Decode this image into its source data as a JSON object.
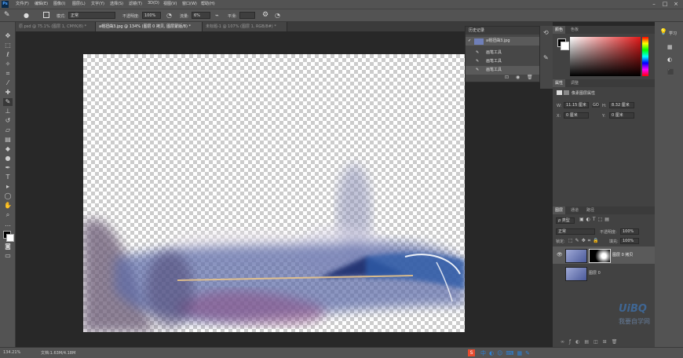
{
  "app": {
    "logo": "Ps"
  },
  "menu": [
    "文件(F)",
    "编辑(E)",
    "图像(I)",
    "图层(L)",
    "文字(Y)",
    "选择(S)",
    "滤镜(T)",
    "3D(D)",
    "视图(V)",
    "窗口(W)",
    "帮助(H)"
  ],
  "options": {
    "mode_label": "模式:",
    "mode_value": "正常",
    "opacity_label": "不透明度:",
    "opacity_value": "100%",
    "flow_label": "流量:",
    "flow_value": "6%",
    "smooth_label": "平滑:"
  },
  "tabs": [
    {
      "label": "原.psd @ 75.1% (图层 1, CMYK/8) *",
      "active": false
    },
    {
      "label": "a帽扭曲3.jpg @ 134% (图层 0 拷贝, 图层蒙版/8) *",
      "active": true
    },
    {
      "label": "未标题-1 @ 107% (图层 1, RGB/8#) *",
      "active": false
    }
  ],
  "history": {
    "title": "历史记录",
    "snapshot": "a帽扭曲3.jpg",
    "items": [
      "画笔工具",
      "画笔工具",
      "画笔工具"
    ]
  },
  "color_panel": {
    "tabs": [
      "颜色",
      "色板"
    ]
  },
  "properties": {
    "tabs": [
      "属性",
      "调整"
    ],
    "title": "像素图层属性",
    "w_label": "W:",
    "w_value": "11.15 厘米",
    "h_label": "H:",
    "h_value": "8.32 厘米",
    "x_label": "X:",
    "x_value": "0 厘米",
    "y_label": "Y:",
    "y_value": "0 厘米",
    "link": "GO"
  },
  "layers": {
    "tabs": [
      "图层",
      "通道",
      "路径"
    ],
    "filter_label": "ρ 类型",
    "blend": "正常",
    "opacity_label": "不透明度:",
    "opacity_value": "100%",
    "lock_label": "锁定:",
    "fill_label": "填充:",
    "fill_value": "100%",
    "items": [
      {
        "name": "图层 0 拷贝",
        "selected": true
      },
      {
        "name": "图层 0",
        "selected": false
      }
    ]
  },
  "right_icons": {
    "learn": "学习"
  },
  "watermark": {
    "line1": "UiBQ",
    "line2": "我要自学网"
  },
  "status": {
    "zoom": "134.21%",
    "doc": "文档:1.63M/4.18M"
  },
  "colors": {
    "accent": "#2d82d8",
    "bg": "#282828",
    "panel": "#535353"
  }
}
